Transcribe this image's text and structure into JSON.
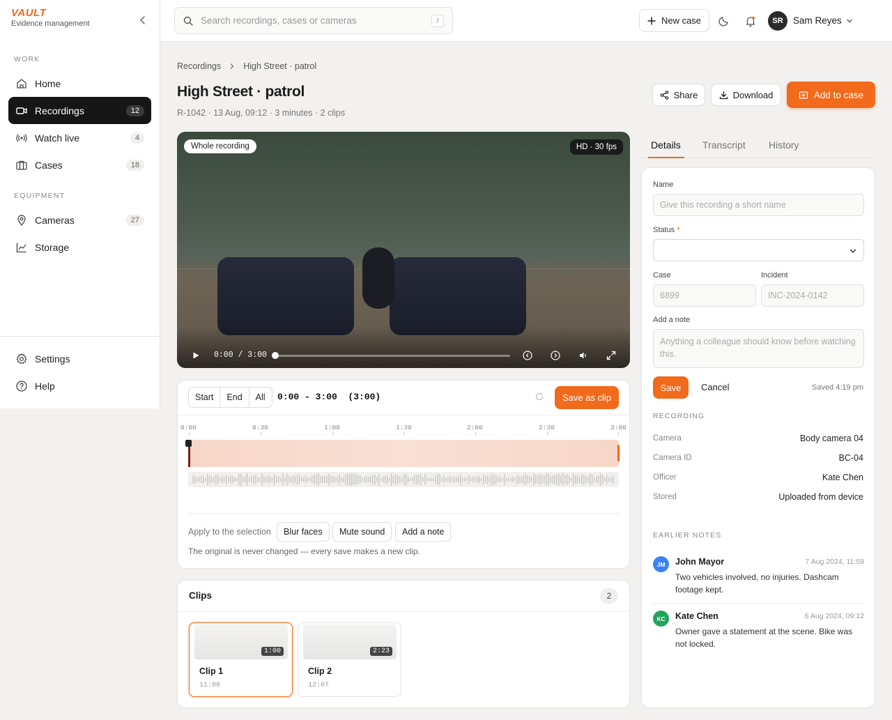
{
  "brand": {
    "logo": "VAULT",
    "subtitle": "Evidence management"
  },
  "sidebar": {
    "sections": [
      {
        "label": "WORK"
      },
      {
        "label": "EQUIPMENT"
      }
    ],
    "items": [
      {
        "label": "Home",
        "count": ""
      },
      {
        "label": "Recordings",
        "count": "12"
      },
      {
        "label": "Watch live",
        "count": "4"
      },
      {
        "label": "Cases",
        "count": "18"
      },
      {
        "label": "Cameras",
        "count": "27"
      },
      {
        "label": "Storage",
        "count": ""
      },
      {
        "label": "Settings",
        "count": ""
      },
      {
        "label": "Help",
        "count": ""
      }
    ]
  },
  "topbar": {
    "search_placeholder": "Search recordings, cases or cameras",
    "search_shortcut": "/",
    "new_case": "New case",
    "user_initials": "SR",
    "user_name": "Sam Reyes"
  },
  "header": {
    "breadcrumbs": [
      "Recordings",
      "High Street · patrol"
    ],
    "title": "High Street · patrol",
    "meta": "R-1042 · 13 Aug, 09:12 · 3 minutes · 2 clips",
    "share": "Share",
    "download": "Download",
    "add_to_case": "Add to case"
  },
  "video": {
    "scope_pill": "Whole recording",
    "quality_pill": "HD · 30 fps",
    "time": "0:00  /  3:00",
    "progress": 0
  },
  "editor": {
    "segments": [
      "Start",
      "End",
      "All"
    ],
    "range": "0:00 - 3:00  (3:00)",
    "save_clip": "Save as clip",
    "ticks": [
      "0:00",
      "0:30",
      "1:00",
      "1:30",
      "2:00",
      "2:30",
      "3:00"
    ],
    "apply_label": "Apply to the selection",
    "actions": [
      "Blur faces",
      "Mute sound",
      "Add a note"
    ],
    "footnote": "The original is never changed — every save makes a new clip."
  },
  "clips": {
    "title": "Clips",
    "count": "2",
    "items": [
      {
        "name": "Clip 1",
        "duration": "1:00",
        "time": "11:00"
      },
      {
        "name": "Clip 2",
        "duration": "2:23",
        "time": "12:07"
      }
    ]
  },
  "details": {
    "tabs": [
      "Details",
      "Transcript",
      "History"
    ],
    "name_label": "Name",
    "name_placeholder": "Give this recording a short name",
    "status_label": "Status",
    "status_required": "*",
    "case_label": "Case",
    "case_value": "6899",
    "incident_label": "Incident",
    "incident_value": "INC-2024-0142",
    "note_label": "Add a note",
    "note_placeholder": "Anything a colleague should know before watching this.",
    "save": "Save",
    "cancel": "Cancel",
    "saved": "Saved 4:19 pm",
    "recording_label": "RECORDING",
    "recording": [
      {
        "key": "Camera",
        "value": "Body camera 04"
      },
      {
        "key": "Camera ID",
        "value": "BC-04"
      },
      {
        "key": "Officer",
        "value": "Kate Chen"
      },
      {
        "key": "Stored",
        "value": "Uploaded from device"
      }
    ],
    "notes_label": "EARLIER NOTES",
    "notes": [
      {
        "initials": "JM",
        "author": "John Mayor",
        "date": "7 Aug 2024, 11:59",
        "text": "Two vehicles involved, no injuries. Dashcam footage kept.",
        "color": "#3b82f6"
      },
      {
        "initials": "KC",
        "author": "Kate Chen",
        "date": "6 Aug 2024, 09:12",
        "text": "Owner gave a statement at the scene. Bike was not locked.",
        "color": "#22a55a"
      }
    ]
  },
  "colors": {
    "accent": "#f26a1b",
    "sidebar_active": "#161616"
  }
}
